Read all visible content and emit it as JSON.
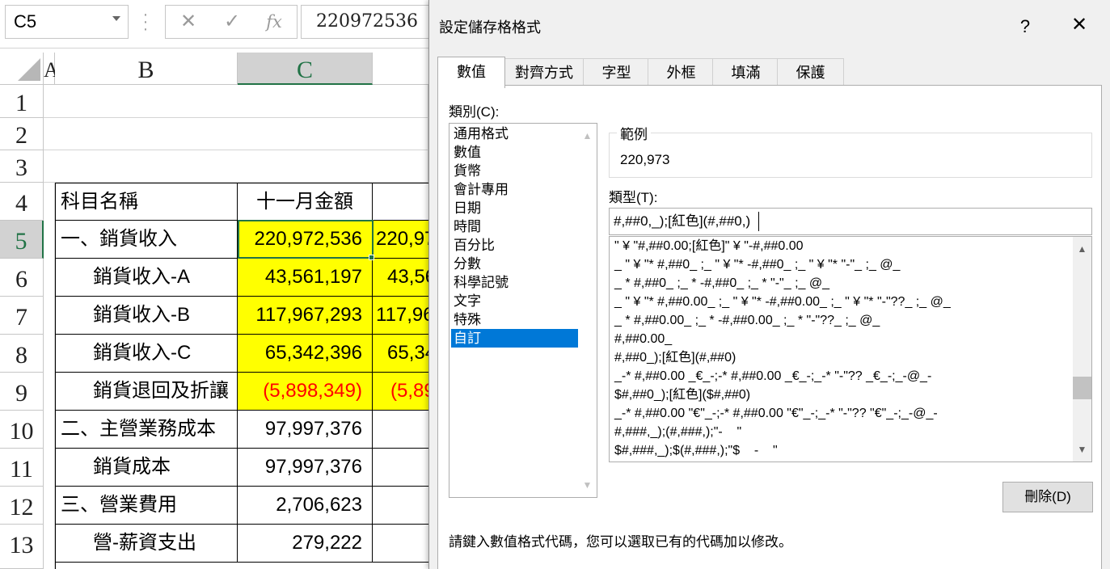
{
  "formula_bar": {
    "name_box": "C5",
    "cancel_icon": "✕",
    "enter_icon": "✓",
    "fx_icon": "fx",
    "formula": "220972536"
  },
  "grid": {
    "columns": [
      "A",
      "B",
      "C"
    ],
    "rows": [
      "1",
      "2",
      "3",
      "4",
      "5",
      "6",
      "7",
      "8",
      "9",
      "10",
      "11",
      "12",
      "13"
    ],
    "header_row": {
      "b": "科目名稱",
      "c": "十一月金額"
    },
    "data_rows": [
      {
        "b": "一、銷貨收入",
        "c": "220,972,536",
        "d": "220,97"
      },
      {
        "b": "銷貨收入-A",
        "c": "43,561,197",
        "d": "43,56"
      },
      {
        "b": "銷貨收入-B",
        "c": "117,967,293",
        "d": "117,96"
      },
      {
        "b": "銷貨收入-C",
        "c": "65,342,396",
        "d": "65,34"
      },
      {
        "b": "銷貨退回及折讓",
        "c": "(5,898,349)",
        "d": "(5,89"
      },
      {
        "b": "二、主營業務成本",
        "c": "97,997,376",
        "d": ""
      },
      {
        "b": "銷貨成本",
        "c": "97,997,376",
        "d": ""
      },
      {
        "b": "三、營業費用",
        "c": "2,706,623",
        "d": ""
      },
      {
        "b": "營-薪資支出",
        "c": "279,222",
        "d": ""
      }
    ],
    "colors": {
      "highlight": "#ffff00",
      "negative": "#ff0000",
      "selection": "#217346"
    }
  },
  "dialog": {
    "title": "設定儲存格格式",
    "help": "?",
    "close": "✕",
    "tabs": [
      "數值",
      "對齊方式",
      "字型",
      "外框",
      "填滿",
      "保護"
    ],
    "category_label": "類別(C):",
    "categories": [
      "通用格式",
      "數值",
      "貨幣",
      "會計專用",
      "日期",
      "時間",
      "百分比",
      "分數",
      "科學記號",
      "文字",
      "特殊",
      "自訂"
    ],
    "selected_category": "自訂",
    "sample_label": "範例",
    "sample_value": "220,973",
    "type_label": "類型(T):",
    "type_value": "#,##0,_);[紅色](#,##0,)",
    "formats": [
      "\" ¥ \"#,##0.00;[紅色]\" ¥ \"-#,##0.00",
      "_ \" ¥ \"* #,##0_ ;_ \" ¥ \"* -#,##0_ ;_ \" ¥ \"* \"-\"_ ;_ @_",
      "_ * #,##0_ ;_ * -#,##0_ ;_ * \"-\"_ ;_ @_",
      "_ \" ¥ \"* #,##0.00_ ;_ \" ¥ \"* -#,##0.00_ ;_ \" ¥ \"* \"-\"??_ ;_ @_",
      "_ * #,##0.00_ ;_ * -#,##0.00_ ;_ * \"-\"??_ ;_ @_",
      "#,##0.00_",
      "#,##0_);[紅色](#,##0)",
      "_-* #,##0.00 _€_-;-* #,##0.00 _€_-;_-* \"-\"?? _€_-;_-@_-",
      "$#,##0_);[紅色]($#,##0)",
      "_-* #,##0.00 \"€\"_-;-* #,##0.00 \"€\"_-;_-* \"-\"?? \"€\"_-;_-@_-",
      "#,###,_);(#,###,);\"-    \"",
      "$#,###,_);$(#,###,);\"$    -    \""
    ],
    "delete_button": "刪除(D)",
    "hint": "請鍵入數值格式代碼，您可以選取已有的代碼加以修改。"
  }
}
